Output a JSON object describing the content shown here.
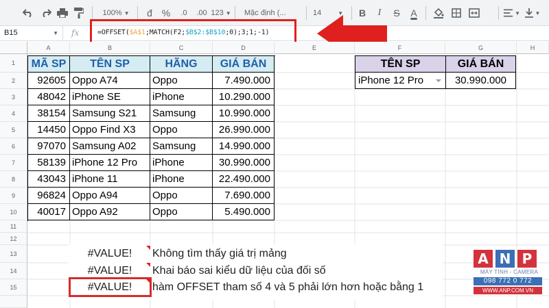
{
  "toolbar": {
    "zoom": "100%",
    "currency": "đ",
    "percent": "%",
    "dec_decrease": ".0",
    "dec_increase": ".00",
    "more_formats": "123",
    "font": "Mặc định (...",
    "font_size": "14",
    "bold": "B",
    "italic": "I",
    "strike": "S",
    "text_color": "A"
  },
  "formula_bar": {
    "cell_ref": "B15",
    "fx": "fx",
    "formula_parts": [
      "=OFFSET(",
      "$A$1",
      ";MATCH(F2;",
      "$B$2:$B$10",
      ";0);3;1;-1)"
    ]
  },
  "columns": [
    "A",
    "B",
    "C",
    "D",
    "E",
    "F",
    "G",
    "H"
  ],
  "rows": [
    "1",
    "2",
    "3",
    "4",
    "5",
    "6",
    "7",
    "8",
    "9",
    "10",
    "11",
    "12",
    "13",
    "14",
    "15"
  ],
  "table": {
    "headers": [
      "MÃ SP",
      "TÊN SP",
      "HÃNG",
      "GIÁ BÁN"
    ],
    "rows": [
      [
        "92605",
        "Oppo A74",
        "Oppo",
        "7.490.000"
      ],
      [
        "48042",
        "iPhone SE",
        "iPhone",
        "10.290.000"
      ],
      [
        "38154",
        "Samsung S21",
        "Samsung",
        "10.990.000"
      ],
      [
        "14450",
        "Oppo Find X3",
        "Oppo",
        "26.990.000"
      ],
      [
        "97070",
        "Samsung A02",
        "Samsung",
        "14.990.000"
      ],
      [
        "58139",
        "iPhone 12 Pro",
        "iPhone",
        "30.990.000"
      ],
      [
        "43043",
        "iPhone 11",
        "iPhone",
        "22.490.000"
      ],
      [
        "96824",
        "Oppo A94",
        "Oppo",
        "7.690.000"
      ],
      [
        "40017",
        "Oppo A92",
        "Oppo",
        "5.490.000"
      ]
    ]
  },
  "lookup": {
    "header_name": "TÊN SP",
    "header_price": "GIÁ BÁN",
    "selected_name": "iPhone 12 Pro",
    "price": "30.990.000"
  },
  "errors": [
    {
      "value": "#VALUE!",
      "text": "Không tìm thấy giá trị mảng"
    },
    {
      "value": "#VALUE!",
      "text": "Khai báo sai kiểu dữ liệu của đối số"
    },
    {
      "value": "#VALUE!",
      "text": "hàm OFFSET tham số  4 và 5 phải lớn hơn hoặc bằng 1"
    }
  ],
  "logo": {
    "letters": [
      "A",
      "N",
      "P"
    ],
    "tagline": "MÁY TÍNH - CAMERA",
    "phone": "098 772 0 772",
    "url": "WWW.ANP.COM.VN"
  },
  "colors": {
    "table_header_bg": "#d6ecf3",
    "table_header_text": "#1f5fa8",
    "lookup_header_bg": "#d9d2e9",
    "highlight_red": "#e0201e"
  }
}
